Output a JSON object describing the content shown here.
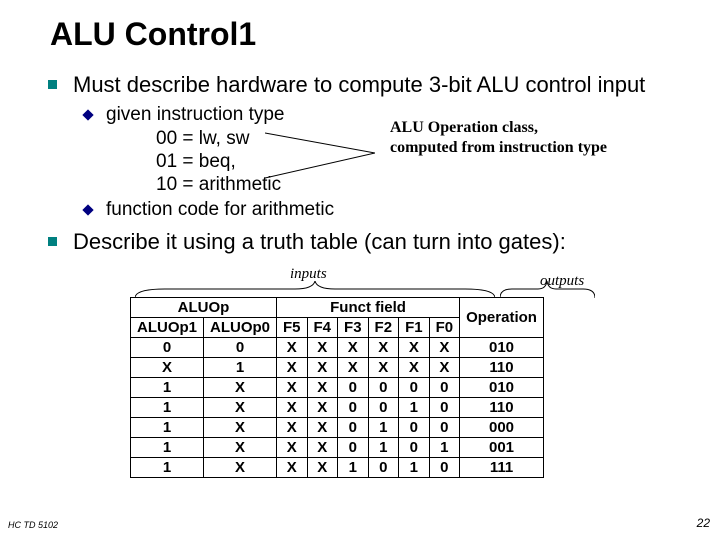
{
  "title": "ALU Control1",
  "bullets": {
    "main1": "Must describe hardware to compute 3-bit ALU control input",
    "sub1": "given instruction type",
    "codes": {
      "a": "00 = lw, sw",
      "b": "01 = beq,",
      "c": "10 = arithmetic"
    },
    "sub2": "function code for arithmetic",
    "main2": "Describe it using a truth table (can turn into gates):"
  },
  "note": {
    "line1": "ALU Operation class,",
    "line2": "computed from instruction type"
  },
  "annotations": {
    "inputs": "inputs",
    "outputs": "outputs"
  },
  "table": {
    "headers": {
      "aluop": "ALUOp",
      "funct": "Funct field",
      "operation": "Operation",
      "aluop1": "ALUOp1",
      "aluop0": "ALUOp0",
      "f5": "F5",
      "f4": "F4",
      "f3": "F3",
      "f2": "F2",
      "f1": "F1",
      "f0": "F0"
    },
    "rows": [
      {
        "a1": "0",
        "a0": "0",
        "f5": "X",
        "f4": "X",
        "f3": "X",
        "f2": "X",
        "f1": "X",
        "f0": "X",
        "op": "010"
      },
      {
        "a1": "X",
        "a0": "1",
        "f5": "X",
        "f4": "X",
        "f3": "X",
        "f2": "X",
        "f1": "X",
        "f0": "X",
        "op": "110"
      },
      {
        "a1": "1",
        "a0": "X",
        "f5": "X",
        "f4": "X",
        "f3": "0",
        "f2": "0",
        "f1": "0",
        "f0": "0",
        "op": "010"
      },
      {
        "a1": "1",
        "a0": "X",
        "f5": "X",
        "f4": "X",
        "f3": "0",
        "f2": "0",
        "f1": "1",
        "f0": "0",
        "op": "110"
      },
      {
        "a1": "1",
        "a0": "X",
        "f5": "X",
        "f4": "X",
        "f3": "0",
        "f2": "1",
        "f1": "0",
        "f0": "0",
        "op": "000"
      },
      {
        "a1": "1",
        "a0": "X",
        "f5": "X",
        "f4": "X",
        "f3": "0",
        "f2": "1",
        "f1": "0",
        "f0": "1",
        "op": "001"
      },
      {
        "a1": "1",
        "a0": "X",
        "f5": "X",
        "f4": "X",
        "f3": "1",
        "f2": "0",
        "f1": "1",
        "f0": "0",
        "op": "111"
      }
    ]
  },
  "footer": {
    "left": "HC  TD 5102",
    "right": "22"
  }
}
